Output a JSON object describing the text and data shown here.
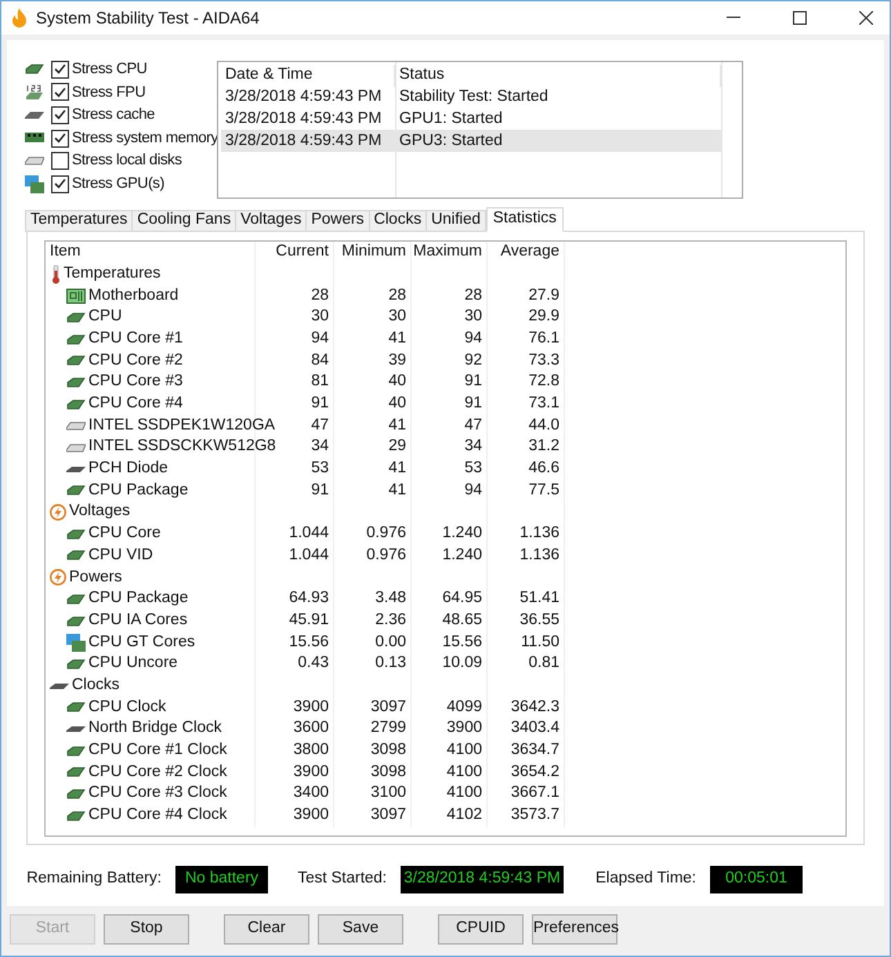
{
  "window": {
    "title": "System Stability Test - AIDA64"
  },
  "stress_options": [
    {
      "label": "Stress CPU",
      "checked": true,
      "kind": "cpu"
    },
    {
      "label": "Stress FPU",
      "checked": true,
      "kind": "fpu"
    },
    {
      "label": "Stress cache",
      "checked": true,
      "kind": "cache"
    },
    {
      "label": "Stress system memory",
      "checked": true,
      "kind": "memory"
    },
    {
      "label": "Stress local disks",
      "checked": false,
      "kind": "disk"
    },
    {
      "label": "Stress GPU(s)",
      "checked": true,
      "kind": "gpu"
    }
  ],
  "log": {
    "columns": [
      "Date & Time",
      "Status"
    ],
    "rows": [
      {
        "cells": [
          "3/28/2018 4:59:43 PM",
          "Stability Test: Started"
        ],
        "selected": false
      },
      {
        "cells": [
          "3/28/2018 4:59:43 PM",
          "GPU1: Started"
        ],
        "selected": false
      },
      {
        "cells": [
          "3/28/2018 4:59:43 PM",
          "GPU3: Started"
        ],
        "selected": true
      }
    ]
  },
  "tabs": [
    {
      "label": "Temperatures",
      "selected": false
    },
    {
      "label": "Cooling Fans",
      "selected": false
    },
    {
      "label": "Voltages",
      "selected": false
    },
    {
      "label": "Powers",
      "selected": false
    },
    {
      "label": "Clocks",
      "selected": false
    },
    {
      "label": "Unified",
      "selected": false
    },
    {
      "label": "Statistics",
      "selected": true
    }
  ],
  "table": {
    "columns": [
      "Item",
      "Current",
      "Minimum",
      "Maximum",
      "Average"
    ],
    "groups": [
      {
        "label": "Temperatures",
        "kind": "thermo",
        "children": [
          {
            "cells": [
              "Motherboard",
              "28",
              "28",
              "28",
              "27.9"
            ],
            "kind": "board"
          },
          {
            "cells": [
              "CPU",
              "30",
              "30",
              "30",
              "29.9"
            ],
            "kind": "cpu"
          },
          {
            "cells": [
              "CPU Core #1",
              "94",
              "41",
              "94",
              "76.1"
            ],
            "kind": "cpu"
          },
          {
            "cells": [
              "CPU Core #2",
              "84",
              "39",
              "92",
              "73.3"
            ],
            "kind": "cpu"
          },
          {
            "cells": [
              "CPU Core #3",
              "81",
              "40",
              "91",
              "72.8"
            ],
            "kind": "cpu"
          },
          {
            "cells": [
              "CPU Core #4",
              "91",
              "40",
              "91",
              "73.1"
            ],
            "kind": "cpu"
          },
          {
            "cells": [
              "INTEL SSDPEK1W120GA",
              "47",
              "41",
              "47",
              "44.0"
            ],
            "kind": "disk"
          },
          {
            "cells": [
              "INTEL SSDSCKKW512G8",
              "34",
              "29",
              "34",
              "31.2"
            ],
            "kind": "disk"
          },
          {
            "cells": [
              "PCH Diode",
              "53",
              "41",
              "53",
              "46.6"
            ],
            "kind": "bridge"
          },
          {
            "cells": [
              "CPU Package",
              "91",
              "41",
              "94",
              "77.5"
            ],
            "kind": "cpu"
          }
        ]
      },
      {
        "label": "Voltages",
        "kind": "bolt",
        "children": [
          {
            "cells": [
              "CPU Core",
              "1.044",
              "0.976",
              "1.240",
              "1.136"
            ],
            "kind": "cpu"
          },
          {
            "cells": [
              "CPU VID",
              "1.044",
              "0.976",
              "1.240",
              "1.136"
            ],
            "kind": "cpu"
          }
        ]
      },
      {
        "label": "Powers",
        "kind": "bolt",
        "children": [
          {
            "cells": [
              "CPU Package",
              "64.93",
              "3.48",
              "64.95",
              "51.41"
            ],
            "kind": "cpu"
          },
          {
            "cells": [
              "CPU IA Cores",
              "45.91",
              "2.36",
              "48.65",
              "36.55"
            ],
            "kind": "cpu"
          },
          {
            "cells": [
              "CPU GT Cores",
              "15.56",
              "0.00",
              "15.56",
              "11.50"
            ],
            "kind": "gpu"
          },
          {
            "cells": [
              "CPU Uncore",
              "0.43",
              "0.13",
              "10.09",
              "0.81"
            ],
            "kind": "cpu"
          }
        ]
      },
      {
        "label": "Clocks",
        "kind": "bridge",
        "children": [
          {
            "cells": [
              "CPU Clock",
              "3900",
              "3097",
              "4099",
              "3642.3"
            ],
            "kind": "cpu"
          },
          {
            "cells": [
              "North Bridge Clock",
              "3600",
              "2799",
              "3900",
              "3403.4"
            ],
            "kind": "bridge"
          },
          {
            "cells": [
              "CPU Core #1 Clock",
              "3800",
              "3098",
              "4100",
              "3634.7"
            ],
            "kind": "cpu"
          },
          {
            "cells": [
              "CPU Core #2 Clock",
              "3900",
              "3098",
              "4100",
              "3654.2"
            ],
            "kind": "cpu"
          },
          {
            "cells": [
              "CPU Core #3 Clock",
              "3400",
              "3100",
              "4100",
              "3667.1"
            ],
            "kind": "cpu"
          },
          {
            "cells": [
              "CPU Core #4 Clock",
              "3900",
              "3097",
              "4102",
              "3573.7"
            ],
            "kind": "cpu"
          }
        ]
      }
    ]
  },
  "status": [
    {
      "label": "Remaining Battery:",
      "value": "No battery"
    },
    {
      "label": "Test Started:",
      "value": "3/28/2018 4:59:43 PM"
    },
    {
      "label": "Elapsed Time:",
      "value": "00:05:01"
    }
  ],
  "buttons": [
    {
      "label": "Start",
      "disabled": true
    },
    {
      "label": "Stop",
      "disabled": false
    },
    {
      "label": "Clear",
      "disabled": false
    },
    {
      "label": "Save",
      "disabled": false
    },
    {
      "label": "CPUID",
      "disabled": false
    },
    {
      "label": "Preferences",
      "disabled": false
    }
  ]
}
